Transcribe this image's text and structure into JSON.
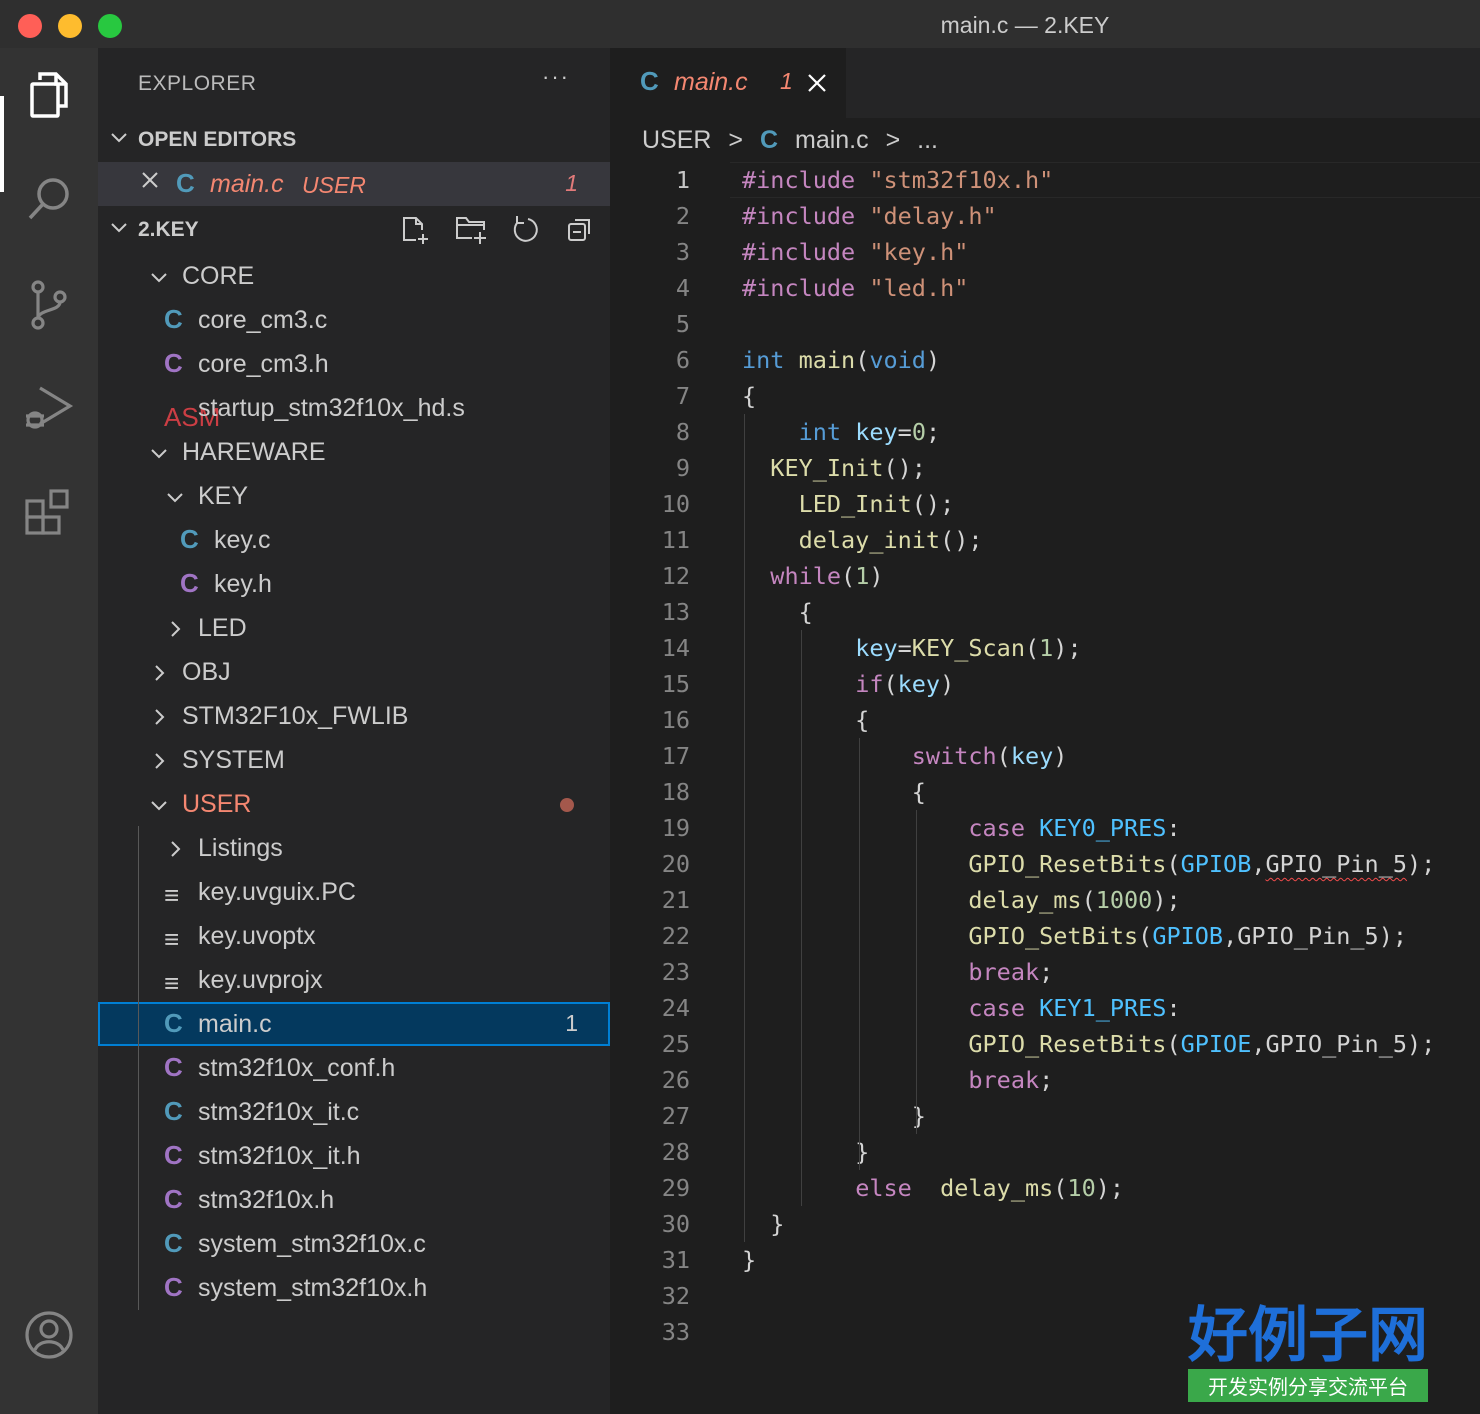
{
  "window": {
    "title": "main.c — 2.KEY"
  },
  "activity_bar": {
    "items": [
      "explorer-icon",
      "search-icon",
      "source-control-icon",
      "run-debug-icon",
      "extensions-icon"
    ],
    "bottom": "account-icon"
  },
  "explorer": {
    "title": "EXPLORER",
    "more": "···",
    "open_editors": {
      "label": "OPEN EDITORS",
      "items": [
        {
          "icon": "C",
          "name": "main.c",
          "folder": "USER",
          "problems": "1"
        }
      ]
    },
    "workspace": {
      "label": "2.KEY",
      "tree": [
        {
          "label": "CORE",
          "type": "folder",
          "expanded": true
        },
        {
          "icon": "C",
          "label": "core_cm3.c",
          "type": "file"
        },
        {
          "icon": "C",
          "label": "core_cm3.h",
          "type": "file"
        },
        {
          "icon": "ASM",
          "label": "startup_stm32f10x_hd.s",
          "type": "file"
        },
        {
          "label": "HAREWARE",
          "type": "folder",
          "expanded": true
        },
        {
          "label": "KEY",
          "type": "folder",
          "expanded": true
        },
        {
          "icon": "C",
          "label": "key.c",
          "type": "file"
        },
        {
          "icon": "C",
          "label": "key.h",
          "type": "file"
        },
        {
          "label": "LED",
          "type": "folder",
          "expanded": false
        },
        {
          "label": "OBJ",
          "type": "folder",
          "expanded": false
        },
        {
          "label": "STM32F10x_FWLIB",
          "type": "folder",
          "expanded": false
        },
        {
          "label": "SYSTEM",
          "type": "folder",
          "expanded": false
        },
        {
          "label": "USER",
          "type": "folder",
          "expanded": true
        },
        {
          "label": "Listings",
          "type": "folder",
          "expanded": false
        },
        {
          "icon": "≡",
          "label": "key.uvguix.PC",
          "type": "file"
        },
        {
          "icon": "≡",
          "label": "key.uvoptx",
          "type": "file"
        },
        {
          "icon": "≡",
          "label": "key.uvprojx",
          "type": "file"
        },
        {
          "icon": "C",
          "label": "main.c",
          "type": "file",
          "problems": "1"
        },
        {
          "icon": "C",
          "label": "stm32f10x_conf.h",
          "type": "file"
        },
        {
          "icon": "C",
          "label": "stm32f10x_it.c",
          "type": "file"
        },
        {
          "icon": "C",
          "label": "stm32f10x_it.h",
          "type": "file"
        },
        {
          "icon": "C",
          "label": "stm32f10x.h",
          "type": "file"
        },
        {
          "icon": "C",
          "label": "system_stm32f10x.c",
          "type": "file"
        },
        {
          "icon": "C",
          "label": "system_stm32f10x.h",
          "type": "file"
        }
      ]
    }
  },
  "editor": {
    "tab": {
      "icon": "C",
      "name": "main.c",
      "problems": "1"
    },
    "breadcrumb": [
      "USER",
      "main.c",
      "..."
    ],
    "breadcrumb_sep": ">",
    "code": [
      "#include \"stm32f10x.h\"",
      "#include \"delay.h\"",
      "#include \"key.h\"",
      "#include \"led.h\"",
      "",
      "int main(void)",
      "{",
      "    int key=0;",
      "  KEY_Init();",
      "    LED_Init();",
      "    delay_init();",
      "  while(1)",
      "    {",
      "        key=KEY_Scan(1);",
      "        if(key)",
      "        {",
      "            switch(key)",
      "            {",
      "                case KEY0_PRES:",
      "                GPIO_ResetBits(GPIOB,GPIO_Pin_5);",
      "                delay_ms(1000);",
      "                GPIO_SetBits(GPIOB,GPIO_Pin_5);",
      "                break;",
      "                case KEY1_PRES:",
      "                GPIO_ResetBits(GPIOE,GPIO_Pin_5);",
      "                break;",
      "            }",
      "        }",
      "        else  delay_ms(10);",
      "  }",
      "}",
      "",
      ""
    ]
  },
  "watermark": {
    "title": "好例子网",
    "subtitle": "开发实例分享交流平台"
  },
  "colors": {
    "titlebar": "#2f2f2f",
    "activitybar": "#333333",
    "sidebar": "#252526",
    "editor": "#1e1e1e",
    "selection": "#04395e",
    "focus_border": "#007fd4",
    "error": "#f48771",
    "modified_dot": "#a4584c"
  }
}
